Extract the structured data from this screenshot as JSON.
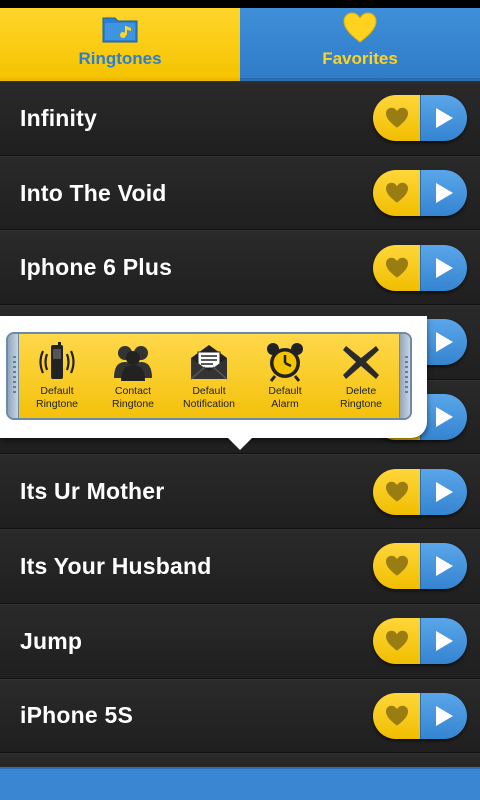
{
  "tabs": [
    {
      "label": "Ringtones",
      "icon": "folder-music-icon",
      "active": true
    },
    {
      "label": "Favorites",
      "icon": "heart-icon",
      "active": false
    }
  ],
  "ringtones": [
    "Infinity",
    "Into The Void",
    "Iphone 6 Plus",
    "",
    "",
    "Its Ur Mother",
    "Its Your Husband",
    "Jump",
    "iPhone 5S"
  ],
  "popup": {
    "actions": [
      {
        "line1": "Default",
        "line2": "Ringtone",
        "icon": "phone-vibrate-icon"
      },
      {
        "line1": "Contact",
        "line2": "Ringtone",
        "icon": "contacts-icon"
      },
      {
        "line1": "Default",
        "line2": "Notification",
        "icon": "envelope-icon"
      },
      {
        "line1": "Default",
        "line2": "Alarm",
        "icon": "alarm-clock-icon"
      },
      {
        "line1": "Delete",
        "line2": "Ringtone",
        "icon": "delete-x-icon"
      }
    ]
  },
  "colors": {
    "yellow": "#f5c400",
    "blue": "#3584d0",
    "row_bg": "#242424"
  }
}
